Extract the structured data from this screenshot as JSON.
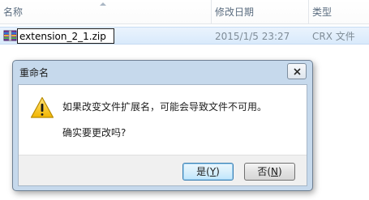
{
  "columns": {
    "name": "名称",
    "date_modified": "修改日期",
    "type": "类型"
  },
  "file": {
    "icon": "archive-icon",
    "name_edit_value": "extension_2_1.zip",
    "date": "2015/1/5 23:27",
    "type": "CRX 文件"
  },
  "dialog": {
    "title": "重命名",
    "message": "如果改变文件扩展名，可能会导致文件不可用。",
    "confirm": "确实要更改吗?",
    "yes_text": "是(",
    "yes_key": "Y",
    "yes_end": ")",
    "no_text": "否(",
    "no_key": "N",
    "no_end": ")"
  }
}
